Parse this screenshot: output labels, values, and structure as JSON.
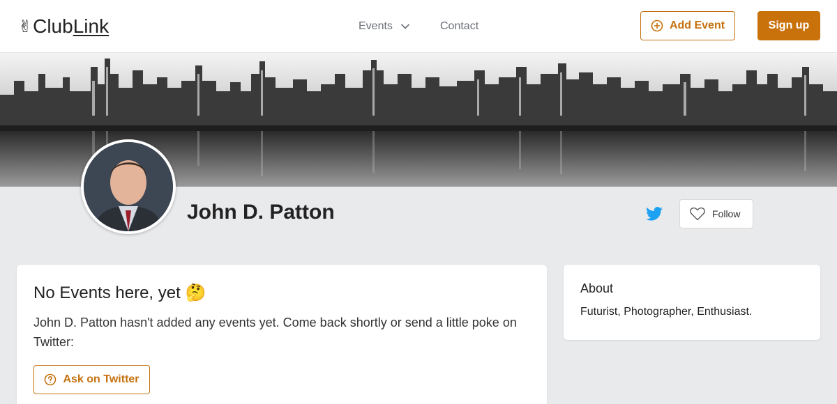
{
  "header": {
    "logo_prefix": "Club",
    "logo_suffix": "Link",
    "logo_emoji": "✌",
    "nav": {
      "events_label": "Events",
      "contact_label": "Contact"
    },
    "add_event_label": "Add Event",
    "signup_label": "Sign up"
  },
  "profile": {
    "name": "John D. Patton",
    "follow_label": "Follow"
  },
  "events_card": {
    "title": "No Events here, yet",
    "title_emoji": "🤔",
    "message": "John D. Patton hasn't added any events yet. Come back shortly or send a little poke on Twitter:",
    "ask_button_label": "Ask on Twitter"
  },
  "about_card": {
    "title": "About",
    "text": "Futurist, Photographer, Enthusiast."
  },
  "colors": {
    "accent": "#c9720b",
    "twitter": "#1da1f2",
    "background": "#e9eaec"
  }
}
